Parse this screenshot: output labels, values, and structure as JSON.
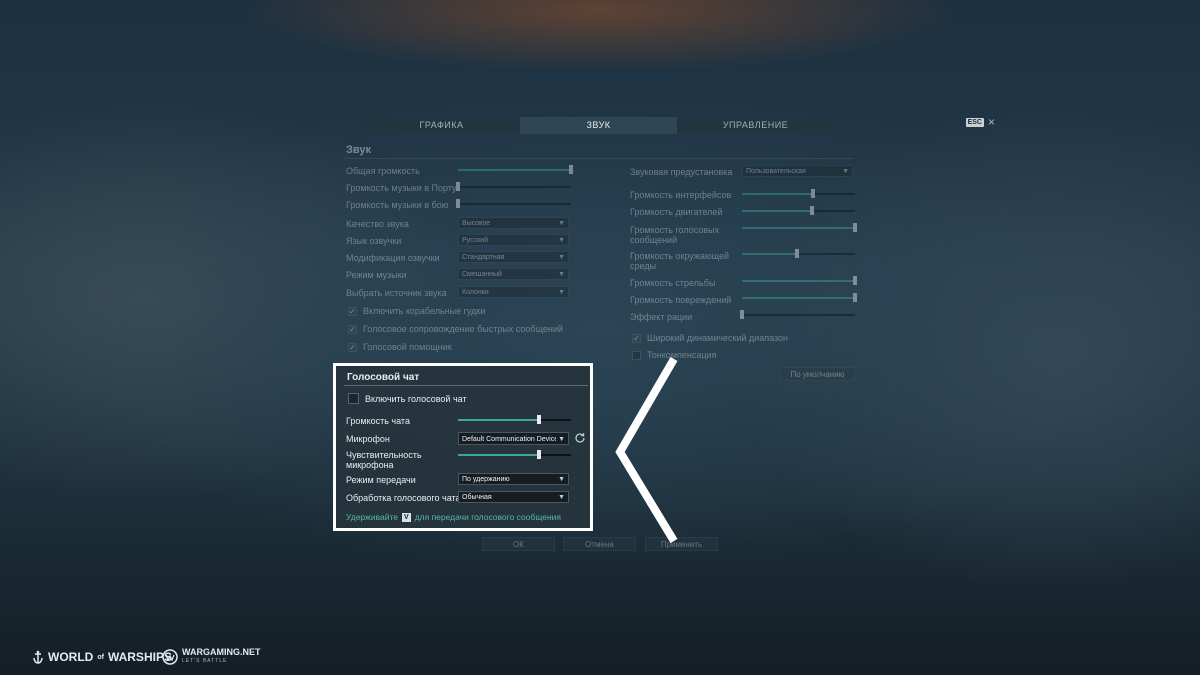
{
  "tabs": [
    {
      "label": "ГРАФИКА",
      "active": false
    },
    {
      "label": "ЗВУК",
      "active": true
    },
    {
      "label": "УПРАВЛЕНИЕ",
      "active": false
    }
  ],
  "esc": {
    "key": "ESC",
    "close": "×"
  },
  "sound": {
    "title": "Звук",
    "left_sliders": [
      {
        "label": "Общая громкость",
        "value": 1.0
      },
      {
        "label": "Громкость музыки в Порту",
        "value": 0.0
      },
      {
        "label": "Громкость музыки в бою",
        "value": 0.0
      }
    ],
    "selects": [
      {
        "label": "Качество звука",
        "value": "Высокое"
      },
      {
        "label": "Язык озвучки",
        "value": "Русский"
      },
      {
        "label": "Модификация озвучки",
        "value": "Стандартная"
      },
      {
        "label": "Режим музыки",
        "value": "Смешанный"
      },
      {
        "label": "Выбрать источник звука",
        "value": "Колонки"
      }
    ],
    "checkboxes": [
      {
        "label": "Включить корабельные гудки",
        "checked": true
      },
      {
        "label": "Голосовое сопровождение быстрых сообщений",
        "checked": true
      },
      {
        "label": "Голосовой помощник",
        "checked": true
      }
    ],
    "preset": {
      "label": "Звуковая предустановка",
      "value": "Пользовательская"
    },
    "right_sliders": [
      {
        "label": "Громкость интерфейсов",
        "value": 0.63
      },
      {
        "label": "Громкость двигателей",
        "value": 0.62
      },
      {
        "label": "Громкость голосовых сообщений",
        "value": 1.0
      },
      {
        "label": "Громкость окружающей среды",
        "value": 0.49
      },
      {
        "label": "Громкость стрельбы",
        "value": 1.0
      },
      {
        "label": "Громкость повреждений",
        "value": 1.0
      },
      {
        "label": "Эффект рации",
        "value": 0.0
      }
    ],
    "right_checkboxes": [
      {
        "label": "Широкий динамический диапазон",
        "checked": true
      },
      {
        "label": "Тонкомпенсация",
        "checked": false
      }
    ],
    "defaults_button": "По умолчанию"
  },
  "voice_chat": {
    "title": "Голосовой чат",
    "enable_label": "Включить голосовой чат",
    "enable_checked": false,
    "volume_label": "Громкость чата",
    "volume_value": 0.72,
    "mic_label": "Микрофон",
    "mic_value": "Default Communication Device",
    "sensitivity_label": "Чувствительность микрофона",
    "sensitivity_value": 0.72,
    "mode_label": "Режим передачи",
    "mode_value": "По удержанию",
    "processing_label": "Обработка голосового чата",
    "processing_value": "Обычная",
    "hint_before": "Удерживайте",
    "hint_key": "V",
    "hint_after": "для передачи голосового сообщения"
  },
  "buttons": {
    "ok": "ОК",
    "cancel": "Отмена",
    "apply": "Применить"
  },
  "footer": {
    "game_logo_left": "WORLD",
    "game_logo_mid": "of",
    "game_logo_right": "WARSHIPS",
    "publisher": "WARGAMING.NET",
    "publisher_tagline": "LET'S BATTLE"
  }
}
